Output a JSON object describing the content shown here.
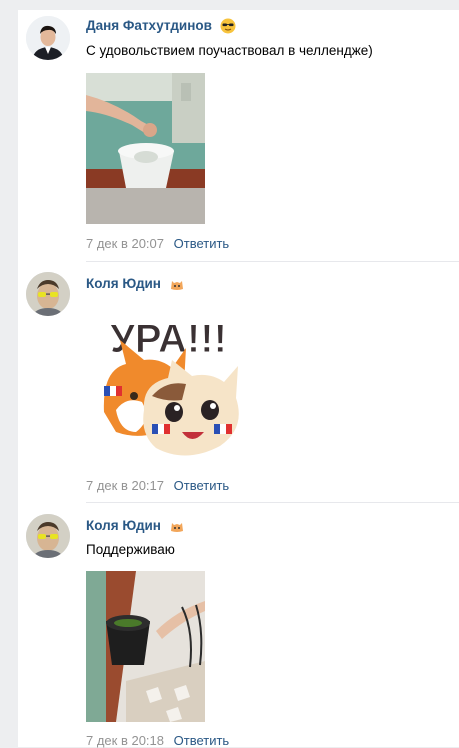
{
  "comments": [
    {
      "author": "Даня Фатхутдинов",
      "author_emoji": "sunglasses-emoji",
      "text": "С удовольствием поучаствовал в челлендже)",
      "attachment": "photo",
      "date": "7 дек в 20:07",
      "reply_label": "Ответить"
    },
    {
      "author": "Коля Юдин",
      "author_emoji": "cat-emoji",
      "text": "",
      "attachment": "sticker",
      "sticker_text": "УРА!!!",
      "date": "7 дек в 20:17",
      "reply_label": "Ответить"
    },
    {
      "author": "Коля Юдин",
      "author_emoji": "cat-emoji",
      "text": "Поддерживаю",
      "attachment": "photo",
      "date": "7 дек в 20:18",
      "reply_label": "Ответить"
    }
  ],
  "colors": {
    "link": "#2a5885",
    "meta": "#939393",
    "background": "#edeef0"
  }
}
